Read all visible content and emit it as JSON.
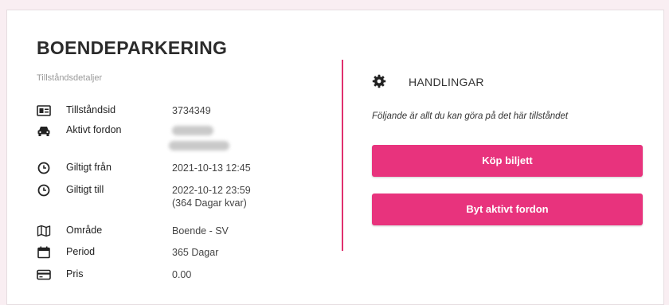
{
  "page": {
    "title": "BOENDEPARKERING",
    "subtitle": "Tillståndsdetaljer"
  },
  "details": [
    {
      "icon": "id-card-icon",
      "label": "Tillståndsid",
      "value": "3734349"
    },
    {
      "icon": "car-icon",
      "label": "Aktivt fordon",
      "value": ""
    },
    {
      "icon": "clock-icon",
      "label": "Giltigt från",
      "value": "2021-10-13 12:45"
    },
    {
      "icon": "clock-icon",
      "label": "Giltigt till",
      "value": "2022-10-12 23:59",
      "value2": "(364 Dagar kvar)"
    },
    {
      "icon": "map-icon",
      "label": "Område",
      "value": "Boende - SV"
    },
    {
      "icon": "calendar-icon",
      "label": "Period",
      "value": "365 Dagar"
    },
    {
      "icon": "credit-card-icon",
      "label": "Pris",
      "value": "0.00"
    }
  ],
  "actions": {
    "heading": "HANDLINGAR",
    "description": "Följande är allt du kan göra på det här tillståndet",
    "buy_ticket": "Köp biljett",
    "change_vehicle": "Byt aktivt fordon"
  },
  "colors": {
    "accent": "#e8337d",
    "divider": "#e0306e",
    "background": "#f9eef2"
  }
}
